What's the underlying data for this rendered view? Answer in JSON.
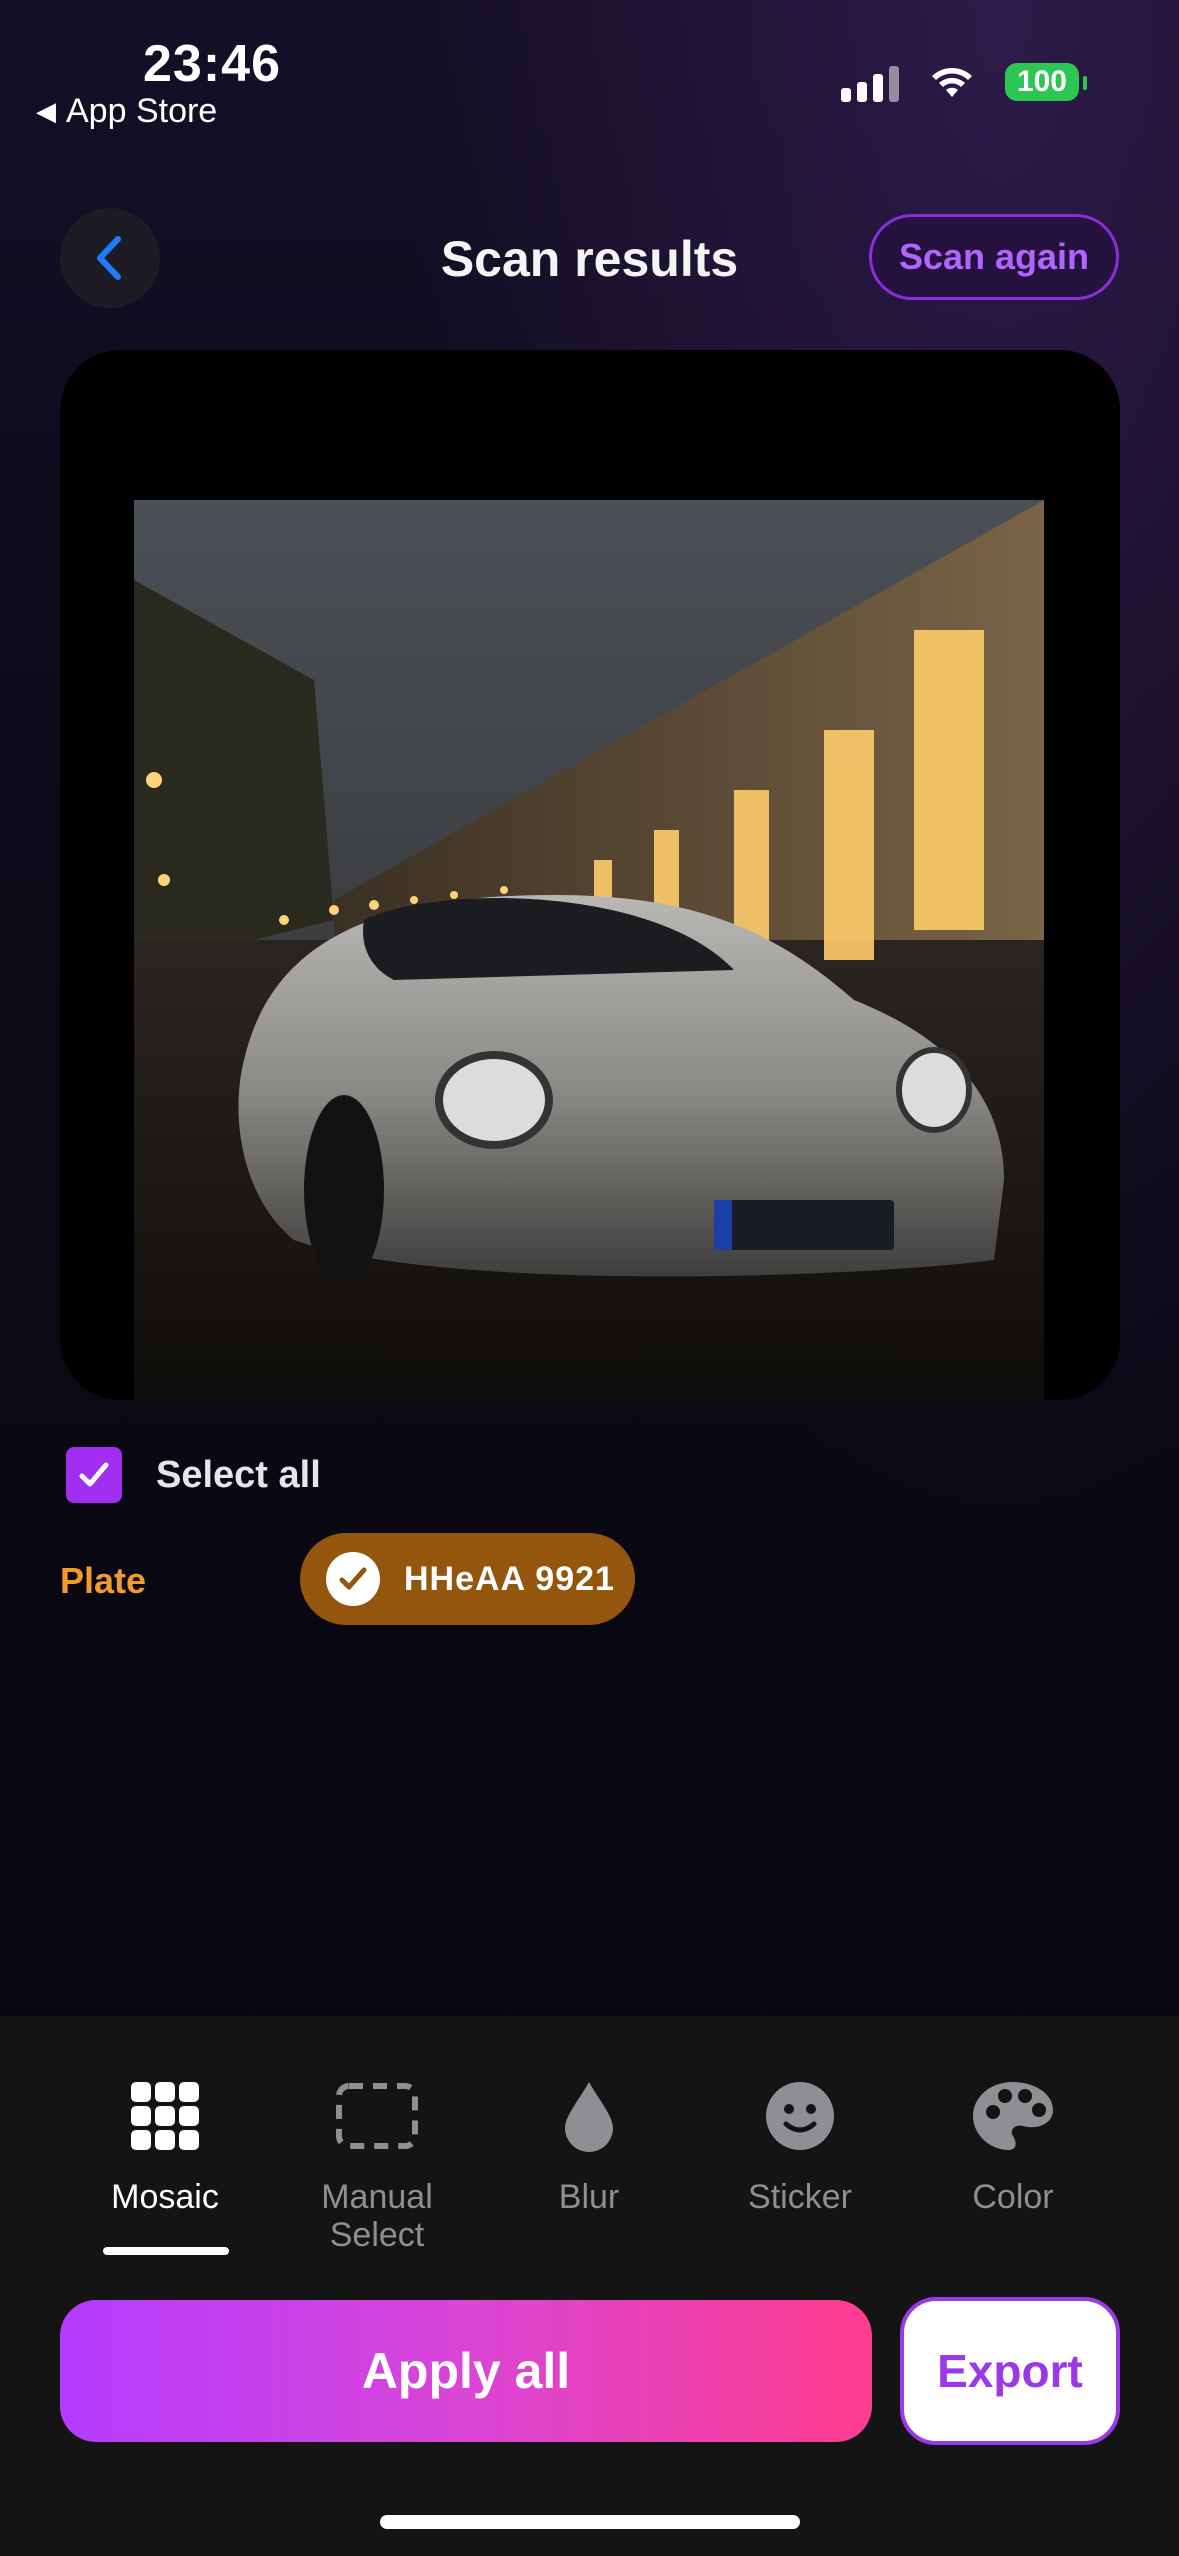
{
  "status_bar": {
    "time": "23:46",
    "back_app": "App Store",
    "battery": "100"
  },
  "header": {
    "title": "Scan results",
    "scan_again": "Scan again"
  },
  "selection": {
    "select_all": "Select all",
    "select_all_checked": true
  },
  "detections": [
    {
      "category": "Plate",
      "value": "HHeAA 9921",
      "checked": true
    }
  ],
  "tools": [
    {
      "label": "Mosaic",
      "icon": "grid-icon",
      "active": true
    },
    {
      "label": "Manual\nSelect",
      "icon": "dashed-rect-icon",
      "active": false
    },
    {
      "label": "Blur",
      "icon": "droplet-icon",
      "active": false
    },
    {
      "label": "Sticker",
      "icon": "smiley-icon",
      "active": false
    },
    {
      "label": "Color",
      "icon": "palette-icon",
      "active": false
    }
  ],
  "actions": {
    "apply_all": "Apply all",
    "export": "Export"
  },
  "colors": {
    "accent_purple": "#a12ef0",
    "plate_orange": "#f39a2c",
    "chip_brown": "#93560c"
  }
}
